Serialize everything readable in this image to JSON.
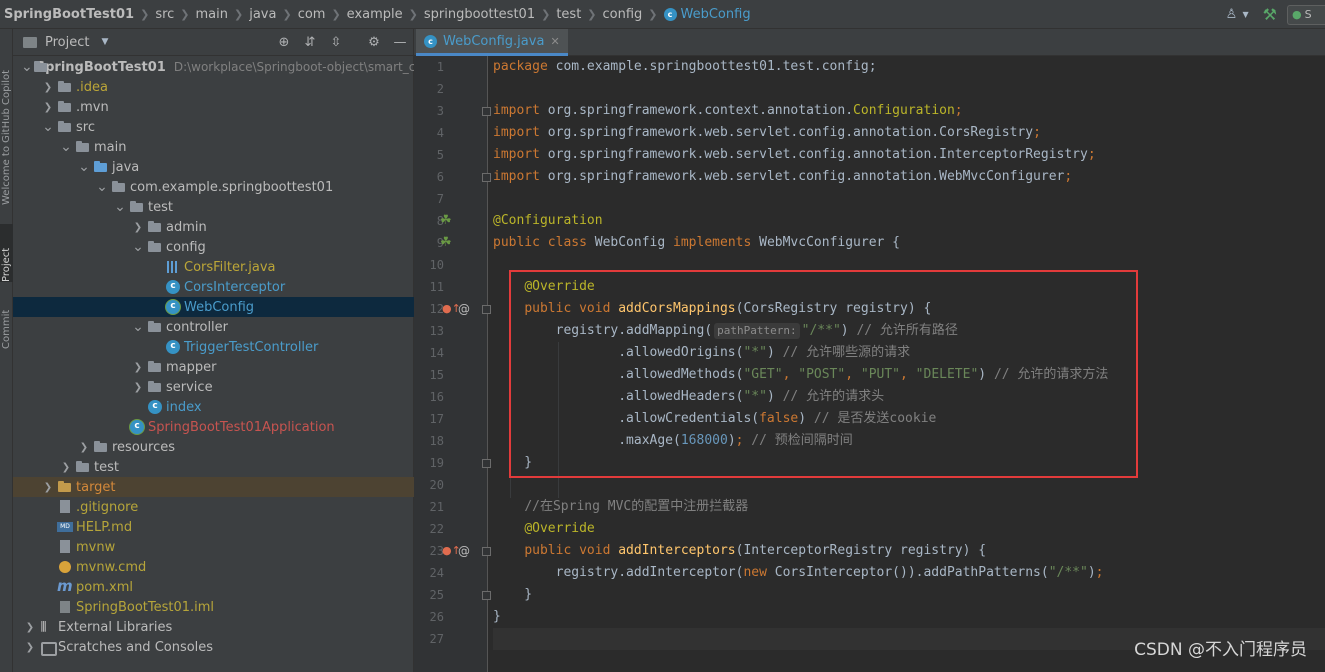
{
  "navbar": {
    "crumbs": [
      "SpringBootTest01",
      "src",
      "main",
      "java",
      "com",
      "example",
      "springboottest01",
      "test",
      "config"
    ],
    "current_class": "WebConfig",
    "run_config_label": "S"
  },
  "tool_strip": {
    "copilot": "Welcome to GitHub Copilot",
    "project": "Project",
    "commit": "Commit"
  },
  "project_panel": {
    "title": "Project",
    "root_path": "D:\\workplace\\Springboot-object\\smart_ca",
    "tree": [
      {
        "label": "SpringBootTest01",
        "depth": 0,
        "expanded": true,
        "icon": "folder",
        "color": "default"
      },
      {
        "label": ".idea",
        "depth": 1,
        "expanded": false,
        "icon": "folder",
        "color": "yellow"
      },
      {
        "label": ".mvn",
        "depth": 1,
        "expanded": false,
        "icon": "folder",
        "color": "default"
      },
      {
        "label": "src",
        "depth": 1,
        "expanded": true,
        "icon": "folder",
        "color": "default"
      },
      {
        "label": "main",
        "depth": 2,
        "expanded": true,
        "icon": "folder",
        "color": "default"
      },
      {
        "label": "java",
        "depth": 3,
        "expanded": true,
        "icon": "folder-blue",
        "color": "default"
      },
      {
        "label": "com.example.springboottest01",
        "depth": 4,
        "expanded": true,
        "icon": "package",
        "color": "default"
      },
      {
        "label": "test",
        "depth": 5,
        "expanded": true,
        "icon": "package",
        "color": "default"
      },
      {
        "label": "admin",
        "depth": 6,
        "expanded": false,
        "icon": "package",
        "color": "default"
      },
      {
        "label": "config",
        "depth": 6,
        "expanded": true,
        "icon": "package",
        "color": "default"
      },
      {
        "label": "CorsFilter.java",
        "depth": 7,
        "expanded": null,
        "icon": "filter",
        "color": "yellow"
      },
      {
        "label": "CorsInterceptor",
        "depth": 7,
        "expanded": null,
        "icon": "class",
        "color": "class"
      },
      {
        "label": "WebConfig",
        "depth": 7,
        "expanded": null,
        "icon": "class-spring",
        "color": "class"
      },
      {
        "label": "controller",
        "depth": 6,
        "expanded": true,
        "icon": "package",
        "color": "default"
      },
      {
        "label": "TriggerTestController",
        "depth": 7,
        "expanded": null,
        "icon": "class",
        "color": "class"
      },
      {
        "label": "mapper",
        "depth": 6,
        "expanded": false,
        "icon": "package",
        "color": "default"
      },
      {
        "label": "service",
        "depth": 6,
        "expanded": false,
        "icon": "package",
        "color": "default"
      },
      {
        "label": "index",
        "depth": 6,
        "expanded": null,
        "icon": "class",
        "color": "class"
      },
      {
        "label": "SpringBootTest01Application",
        "depth": 5,
        "expanded": null,
        "icon": "class-spring",
        "color": "red"
      },
      {
        "label": "resources",
        "depth": 3,
        "expanded": false,
        "icon": "folder",
        "color": "default"
      },
      {
        "label": "test",
        "depth": 2,
        "expanded": false,
        "icon": "folder",
        "color": "default"
      },
      {
        "label": "target",
        "depth": 1,
        "expanded": false,
        "icon": "folder-orange",
        "color": "orange"
      },
      {
        "label": ".gitignore",
        "depth": 1,
        "expanded": null,
        "icon": "file",
        "color": "olive"
      },
      {
        "label": "HELP.md",
        "depth": 1,
        "expanded": null,
        "icon": "md",
        "color": "olive"
      },
      {
        "label": "mvnw",
        "depth": 1,
        "expanded": null,
        "icon": "file",
        "color": "olive"
      },
      {
        "label": "mvnw.cmd",
        "depth": 1,
        "expanded": null,
        "icon": "cmd",
        "color": "olive"
      },
      {
        "label": "pom.xml",
        "depth": 1,
        "expanded": null,
        "icon": "maven",
        "color": "olive"
      },
      {
        "label": "SpringBootTest01.iml",
        "depth": 1,
        "expanded": null,
        "icon": "iml",
        "color": "olive"
      },
      {
        "label": "External Libraries",
        "depth": 0,
        "expanded": false,
        "icon": "library",
        "color": "default"
      },
      {
        "label": "Scratches and Consoles",
        "depth": 0,
        "expanded": false,
        "icon": "scratch",
        "color": "default"
      }
    ]
  },
  "editor": {
    "tab_label": "WebConfig.java",
    "hint_label": "pathPattern:",
    "line_numbers": [
      "1",
      "2",
      "3",
      "4",
      "5",
      "6",
      "7",
      "8",
      "9",
      "10",
      "11",
      "12",
      "13",
      "14",
      "15",
      "16",
      "17",
      "18",
      "19",
      "20",
      "21",
      "22",
      "23",
      "24",
      "25",
      "26",
      "27"
    ],
    "lines": [
      [
        [
          "kw",
          "package "
        ],
        [
          "",
          "com.example.springboottest01.test.config;"
        ]
      ],
      [],
      [
        [
          "kw",
          "import "
        ],
        [
          "",
          "org.springframework.context.annotation."
        ],
        [
          "an",
          "Configuration"
        ],
        [
          "kw",
          ";"
        ]
      ],
      [
        [
          "kw",
          "import "
        ],
        [
          "",
          "org.springframework.web.servlet.config.annotation.CorsRegistry"
        ],
        [
          "kw",
          ";"
        ]
      ],
      [
        [
          "kw",
          "import "
        ],
        [
          "",
          "org.springframework.web.servlet.config.annotation.InterceptorRegistry"
        ],
        [
          "kw",
          ";"
        ]
      ],
      [
        [
          "kw",
          "import "
        ],
        [
          "",
          "org.springframework.web.servlet.config.annotation.WebMvcConfigurer"
        ],
        [
          "kw",
          ";"
        ]
      ],
      [],
      [
        [
          "an",
          "@Configuration"
        ]
      ],
      [
        [
          "kw",
          "public class "
        ],
        [
          "",
          "WebConfig "
        ],
        [
          "kw",
          "implements "
        ],
        [
          "",
          "WebMvcConfigurer {"
        ]
      ],
      [],
      [
        [
          "",
          "    "
        ],
        [
          "an",
          "@Override"
        ]
      ],
      [
        [
          "",
          "    "
        ],
        [
          "kw",
          "public void "
        ],
        [
          "fn",
          "addCorsMappings"
        ],
        [
          "",
          "(CorsRegistry registry) {"
        ]
      ],
      [
        [
          "",
          "        registry.addMapping("
        ],
        [
          "hint",
          "pathPattern:"
        ],
        [
          "st",
          "\"/**\""
        ],
        [
          "",
          ") "
        ],
        [
          "cm",
          "// 允许所有路径"
        ]
      ],
      [
        [
          "",
          "                .allowedOrigins("
        ],
        [
          "st",
          "\"*\""
        ],
        [
          "",
          ") "
        ],
        [
          "cm",
          "// 允许哪些源的请求"
        ]
      ],
      [
        [
          "",
          "                .allowedMethods("
        ],
        [
          "st",
          "\"GET\""
        ],
        [
          "kw",
          ", "
        ],
        [
          "st",
          "\"POST\""
        ],
        [
          "kw",
          ", "
        ],
        [
          "st",
          "\"PUT\""
        ],
        [
          "kw",
          ", "
        ],
        [
          "st",
          "\"DELETE\""
        ],
        [
          "",
          ") "
        ],
        [
          "cm",
          "// 允许的请求方法"
        ]
      ],
      [
        [
          "",
          "                .allowedHeaders("
        ],
        [
          "st",
          "\"*\""
        ],
        [
          "",
          ") "
        ],
        [
          "cm",
          "// 允许的请求头"
        ]
      ],
      [
        [
          "",
          "                .allowCredentials("
        ],
        [
          "kw",
          "false"
        ],
        [
          "",
          ") "
        ],
        [
          "cm",
          "// 是否发送cookie"
        ]
      ],
      [
        [
          "",
          "                .maxAge("
        ],
        [
          "nm",
          "168000"
        ],
        [
          "",
          ")"
        ],
        [
          "kw",
          ";"
        ],
        [
          "cm",
          " // 预检间隔时间"
        ]
      ],
      [
        [
          "",
          "    }"
        ]
      ],
      [],
      [
        [
          "",
          "    "
        ],
        [
          "cm",
          "//在Spring MVC的配置中注册拦截器"
        ]
      ],
      [
        [
          "",
          "    "
        ],
        [
          "an",
          "@Override"
        ]
      ],
      [
        [
          "",
          "    "
        ],
        [
          "kw",
          "public void "
        ],
        [
          "fn",
          "addInterceptors"
        ],
        [
          "",
          "(InterceptorRegistry registry) {"
        ]
      ],
      [
        [
          "",
          "        registry.addInterceptor("
        ],
        [
          "kw",
          "new "
        ],
        [
          "",
          "CorsInterceptor()).addPathPatterns("
        ],
        [
          "st",
          "\"/**\""
        ],
        [
          "",
          ")"
        ],
        [
          "kw",
          ";"
        ]
      ],
      [
        [
          "",
          "    }"
        ]
      ],
      [
        [
          "",
          "}"
        ]
      ],
      []
    ]
  },
  "watermark": "CSDN @不入门程序员"
}
